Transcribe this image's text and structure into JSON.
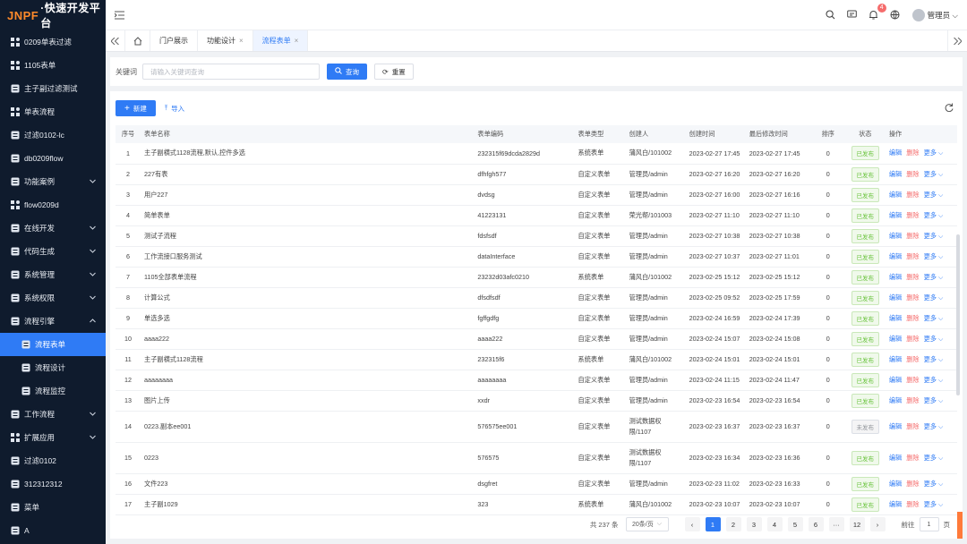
{
  "colors": {
    "accent": "#2f7bf5",
    "sidebar_bg": "#0f1b2d",
    "brand_orange": "#ff8a2a",
    "danger": "#f56c6c",
    "success": "#67c23a"
  },
  "logo": {
    "brand": "JNPF",
    "name": "·快速开发平台"
  },
  "sidebar": {
    "items": [
      {
        "label": "0209单表过滤",
        "icon": "grid-icon"
      },
      {
        "label": "1105表单",
        "icon": "grid-icon"
      },
      {
        "label": "主子副过滤测试",
        "icon": "doc-icon"
      },
      {
        "label": "单表流程",
        "icon": "grid-icon"
      },
      {
        "label": "过滤0102-lc",
        "icon": "list-icon"
      },
      {
        "label": "db0209flow",
        "icon": "db-icon"
      },
      {
        "label": "功能案例",
        "icon": "folder-icon",
        "expandable": true
      },
      {
        "label": "flow0209d",
        "icon": "grid-icon"
      },
      {
        "label": "在线开发",
        "icon": "code-icon",
        "expandable": true
      },
      {
        "label": "代码生成",
        "icon": "calendar-icon",
        "expandable": true
      },
      {
        "label": "系统管理",
        "icon": "gear-icon",
        "expandable": true
      },
      {
        "label": "系统权限",
        "icon": "shield-icon",
        "expandable": true
      },
      {
        "label": "流程引擎",
        "icon": "flow-icon",
        "expandable": true,
        "expanded": true
      },
      {
        "label": "流程表单",
        "icon": "table-icon",
        "sub": true,
        "active": true
      },
      {
        "label": "流程设计",
        "icon": "design-icon",
        "sub": true
      },
      {
        "label": "流程监控",
        "icon": "monitor-icon",
        "sub": true
      },
      {
        "label": "工作流程",
        "icon": "flow-icon",
        "expandable": true
      },
      {
        "label": "扩展应用",
        "icon": "grid-icon",
        "expandable": true
      },
      {
        "label": "过滤0102",
        "icon": "list-icon"
      },
      {
        "label": "312312312",
        "icon": "list-icon"
      },
      {
        "label": "菜单",
        "icon": "list-icon"
      },
      {
        "label": "A",
        "icon": "list-icon"
      }
    ]
  },
  "header": {
    "notification_count": "4",
    "user": "管理员"
  },
  "tabs": [
    {
      "label": "门户展示",
      "closable": false
    },
    {
      "label": "功能设计",
      "closable": true
    },
    {
      "label": "流程表单",
      "closable": true,
      "active": true
    }
  ],
  "search": {
    "label": "关键词",
    "placeholder": "请输入关键词查询",
    "query_label": "查询",
    "reset_label": "重置"
  },
  "toolbar": {
    "new_label": "新建",
    "import_label": "导入"
  },
  "table": {
    "columns": [
      "序号",
      "表单名称",
      "表单编码",
      "表单类型",
      "创建人",
      "创建时间",
      "最后修改时间",
      "排序",
      "状态",
      "操作"
    ],
    "actions": {
      "edit": "编辑",
      "delete": "删除",
      "more": "更多"
    },
    "rows": [
      {
        "no": "1",
        "name": "主子副横式1128流程,默认,控件多选",
        "code": "232315f69dcda2829d",
        "type": "系统表单",
        "creator": "蒲风白/101002",
        "created": "2023-02-27 17:45",
        "modified": "2023-02-27 17:45",
        "sort": "0",
        "status": "已发布",
        "published": true
      },
      {
        "no": "2",
        "name": "227有表",
        "code": "dfhfgh577",
        "type": "自定义表单",
        "creator": "管理员/admin",
        "created": "2023-02-27 16:20",
        "modified": "2023-02-27 16:20",
        "sort": "0",
        "status": "已发布",
        "published": true
      },
      {
        "no": "3",
        "name": "用户227",
        "code": "dvdsg",
        "type": "自定义表单",
        "creator": "管理员/admin",
        "created": "2023-02-27 16:00",
        "modified": "2023-02-27 16:16",
        "sort": "0",
        "status": "已发布",
        "published": true
      },
      {
        "no": "4",
        "name": "简单表单",
        "code": "41223131",
        "type": "自定义表单",
        "creator": "荣光帮/101003",
        "created": "2023-02-27 11:10",
        "modified": "2023-02-27 11:10",
        "sort": "0",
        "status": "已发布",
        "published": true
      },
      {
        "no": "5",
        "name": "测试子流程",
        "code": "fdsfsdf",
        "type": "自定义表单",
        "creator": "管理员/admin",
        "created": "2023-02-27 10:38",
        "modified": "2023-02-27 10:38",
        "sort": "0",
        "status": "已发布",
        "published": true
      },
      {
        "no": "6",
        "name": "工作流接口服务测试",
        "code": "dataInterface",
        "type": "自定义表单",
        "creator": "管理员/admin",
        "created": "2023-02-27 10:37",
        "modified": "2023-02-27 11:01",
        "sort": "0",
        "status": "已发布",
        "published": true
      },
      {
        "no": "7",
        "name": "1105全部表单流程",
        "code": "23232d03afc0210",
        "type": "系统表单",
        "creator": "蒲风白/101002",
        "created": "2023-02-25 15:12",
        "modified": "2023-02-25 15:12",
        "sort": "0",
        "status": "已发布",
        "published": true
      },
      {
        "no": "8",
        "name": "计算公式",
        "code": "dfsdfsdf",
        "type": "自定义表单",
        "creator": "管理员/admin",
        "created": "2023-02-25 09:52",
        "modified": "2023-02-25 17:59",
        "sort": "0",
        "status": "已发布",
        "published": true
      },
      {
        "no": "9",
        "name": "单选多选",
        "code": "fgffgdfg",
        "type": "自定义表单",
        "creator": "管理员/admin",
        "created": "2023-02-24 16:59",
        "modified": "2023-02-24 17:39",
        "sort": "0",
        "status": "已发布",
        "published": true
      },
      {
        "no": "10",
        "name": "aaaa222",
        "code": "aaaa222",
        "type": "自定义表单",
        "creator": "管理员/admin",
        "created": "2023-02-24 15:07",
        "modified": "2023-02-24 15:08",
        "sort": "0",
        "status": "已发布",
        "published": true
      },
      {
        "no": "11",
        "name": "主子副横式1128流程",
        "code": "232315f6",
        "type": "系统表单",
        "creator": "蒲风白/101002",
        "created": "2023-02-24 15:01",
        "modified": "2023-02-24 15:01",
        "sort": "0",
        "status": "已发布",
        "published": true
      },
      {
        "no": "12",
        "name": "aaaaaaaa",
        "code": "aaaaaaaa",
        "type": "自定义表单",
        "creator": "管理员/admin",
        "created": "2023-02-24 11:15",
        "modified": "2023-02-24 11:47",
        "sort": "0",
        "status": "已发布",
        "published": true
      },
      {
        "no": "13",
        "name": "图片上传",
        "code": "xxdr",
        "type": "自定义表单",
        "creator": "管理员/admin",
        "created": "2023-02-23 16:54",
        "modified": "2023-02-23 16:54",
        "sort": "0",
        "status": "已发布",
        "published": true
      },
      {
        "no": "14",
        "name": "0223.副本ee001",
        "code": "576575ee001",
        "type": "自定义表单",
        "creator": "测试数据权限/1107",
        "created": "2023-02-23 16:37",
        "modified": "2023-02-23 16:37",
        "sort": "0",
        "status": "未发布",
        "published": false,
        "tall": true
      },
      {
        "no": "15",
        "name": "0223",
        "code": "576575",
        "type": "自定义表单",
        "creator": "测试数据权限/1107",
        "created": "2023-02-23 16:34",
        "modified": "2023-02-23 16:36",
        "sort": "0",
        "status": "已发布",
        "published": true,
        "tall": true
      },
      {
        "no": "16",
        "name": "文件223",
        "code": "dsgfret",
        "type": "自定义表单",
        "creator": "管理员/admin",
        "created": "2023-02-23 11:02",
        "modified": "2023-02-23 16:33",
        "sort": "0",
        "status": "已发布",
        "published": true
      },
      {
        "no": "17",
        "name": "主子副1029",
        "code": "323",
        "type": "系统表单",
        "creator": "蒲风白/101002",
        "created": "2023-02-23 10:07",
        "modified": "2023-02-23 10:07",
        "sort": "0",
        "status": "已发布",
        "published": true
      }
    ]
  },
  "pagination": {
    "total_text": "共 237 条",
    "page_size": "20条/页",
    "pages": [
      "1",
      "2",
      "3",
      "4",
      "5",
      "6",
      "···",
      "12"
    ],
    "current": "1",
    "goto_label": "前往",
    "goto_value": "1",
    "page_unit": "页"
  }
}
